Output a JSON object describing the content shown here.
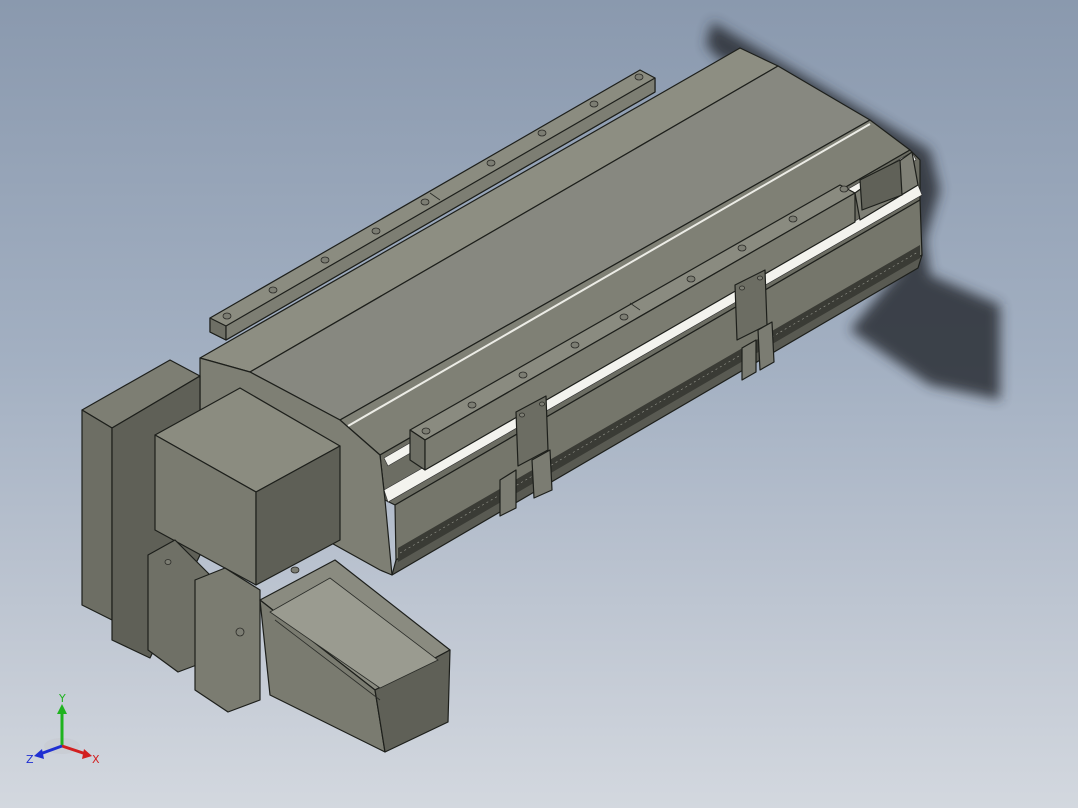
{
  "window": {
    "title": ""
  },
  "viewport": {
    "background_top": "#8a99ae",
    "background_bottom": "#d3d8df",
    "model_face_light": "#8b8c80",
    "model_face_mid": "#7a7b70",
    "model_face_dark": "#5e5f56",
    "model_edge": "#1d1f1b",
    "shadow": "#2b2f36"
  },
  "triad": {
    "x_label": "X",
    "y_label": "Y",
    "z_label": "Z",
    "x_color": "#d21f1f",
    "y_color": "#1fb31f",
    "z_color": "#1f2fd2"
  }
}
